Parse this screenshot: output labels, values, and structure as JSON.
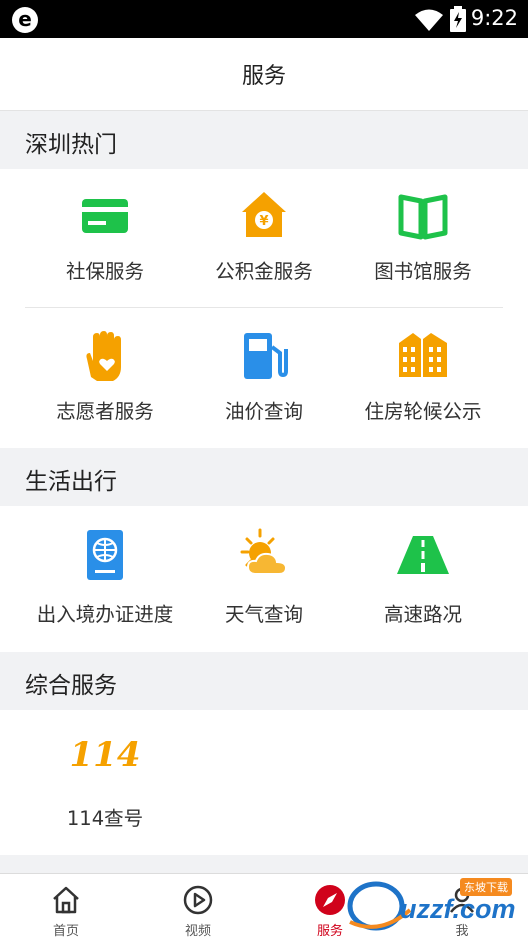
{
  "status_bar": {
    "time": "9:22",
    "app_logo": "e"
  },
  "header": {
    "title": "服务"
  },
  "sections": [
    {
      "title": "深圳热门"
    },
    {
      "title": "生活出行"
    },
    {
      "title": "综合服务"
    }
  ],
  "hot_items": [
    {
      "label": "社保服务",
      "icon": "card-icon"
    },
    {
      "label": "公积金服务",
      "icon": "house-fund-icon"
    },
    {
      "label": "图书馆服务",
      "icon": "book-icon"
    },
    {
      "label": "志愿者服务",
      "icon": "heart-hand-icon"
    },
    {
      "label": "油价查询",
      "icon": "fuel-pump-icon"
    },
    {
      "label": "住房轮候公示",
      "icon": "buildings-icon"
    }
  ],
  "life_items": [
    {
      "label": "出入境办证进度",
      "icon": "passport-icon"
    },
    {
      "label": "天气查询",
      "icon": "weather-icon"
    },
    {
      "label": "高速路况",
      "icon": "highway-icon"
    }
  ],
  "general_items": [
    {
      "label": "114查号",
      "icon_text": "114"
    }
  ],
  "tabs": [
    {
      "label": "首页",
      "icon": "home-icon"
    },
    {
      "label": "视频",
      "icon": "play-icon"
    },
    {
      "label": "服务",
      "icon": "compass-icon",
      "active": true
    },
    {
      "label": "我",
      "icon": "profile-icon"
    }
  ],
  "watermark": {
    "text": "uzzf.com",
    "badge": "东坡下载"
  },
  "colors": {
    "green": "#1ec24a",
    "orange": "#f5a100",
    "blue": "#2a8fe8",
    "active_tab": "#d0021b"
  }
}
